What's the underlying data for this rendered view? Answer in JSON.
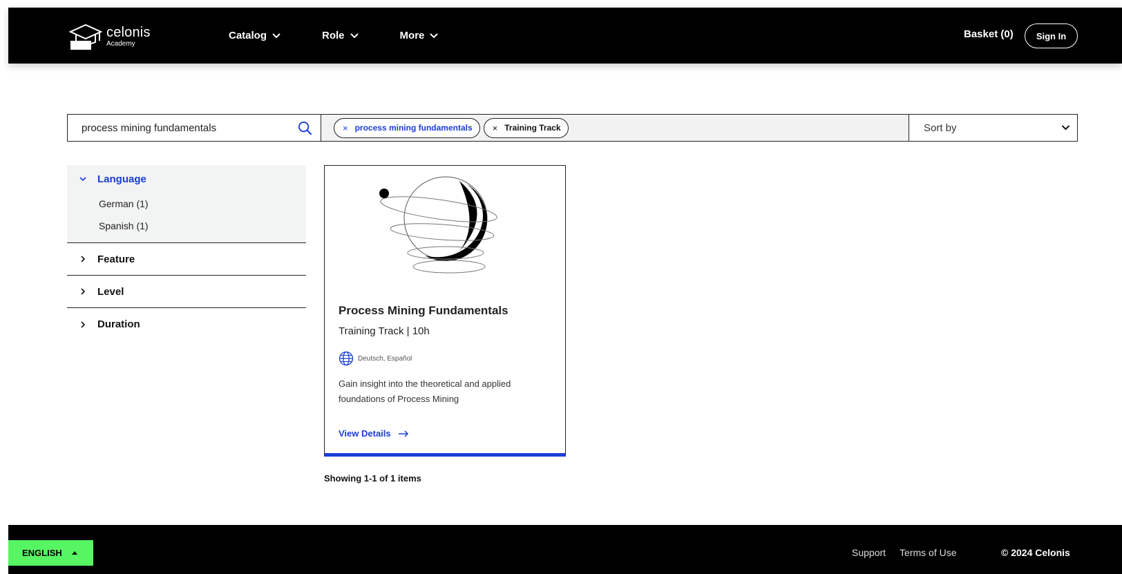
{
  "header": {
    "logo_name": "celonis",
    "logo_sub": "Academy",
    "nav": [
      {
        "label": "Catalog"
      },
      {
        "label": "Role"
      },
      {
        "label": "More"
      }
    ],
    "basket_label": "Basket (0)",
    "signin_label": "Sign In"
  },
  "search": {
    "value": "process mining fundamentals",
    "chips": [
      {
        "label": "process mining fundamentals",
        "remove": "×"
      },
      {
        "label": "Training Track",
        "remove": "×"
      }
    ],
    "sort_label": "Sort by"
  },
  "filters": {
    "groups": [
      {
        "label": "Language",
        "expanded": true,
        "options": [
          "German (1)",
          "Spanish (1)"
        ]
      },
      {
        "label": "Feature",
        "expanded": false
      },
      {
        "label": "Level",
        "expanded": false
      },
      {
        "label": "Duration",
        "expanded": false
      }
    ]
  },
  "results": {
    "card": {
      "title": "Process Mining Fundamentals",
      "meta": "Training Track | 10h",
      "languages": "Deutsch, Español",
      "description": "Gain insight into the theoretical and applied foundations of Process Mining",
      "link_label": "View Details"
    },
    "showing": "Showing 1-1 of 1 items"
  },
  "footer": {
    "language": "ENGLISH",
    "links": [
      "Support",
      "Terms of Use"
    ],
    "copyright": "© 2024 Celonis"
  },
  "colors": {
    "accent_blue": "#1a3dd6",
    "language_button": "#57f463",
    "header_bg": "#000000"
  }
}
